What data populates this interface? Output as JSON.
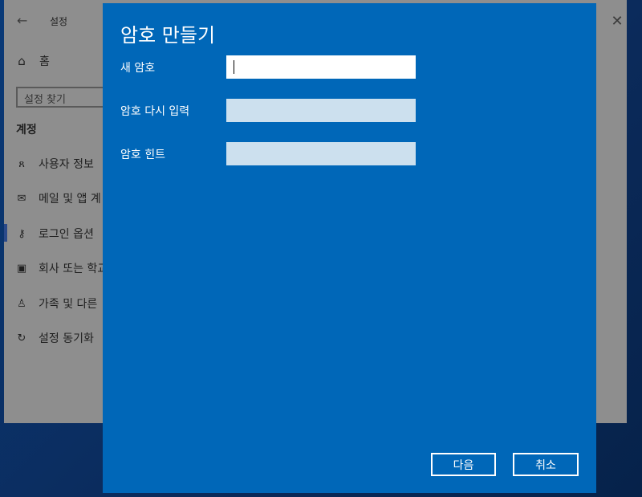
{
  "settings": {
    "title": "설정",
    "home_label": "홈",
    "search_placeholder": "설정 찾기",
    "section": "계정",
    "nav": [
      {
        "icon": "user-info-icon",
        "label": "사용자 정보"
      },
      {
        "icon": "mail-icon",
        "label": "메일 및 앱 계"
      },
      {
        "icon": "key-icon",
        "label": "로그인 옵션"
      },
      {
        "icon": "briefcase-icon",
        "label": "회사 또는 학교"
      },
      {
        "icon": "add-user-icon",
        "label": "가족 및 다른"
      },
      {
        "icon": "sync-icon",
        "label": "설정 동기화"
      }
    ]
  },
  "dialog": {
    "title": "암호 만들기",
    "new_password_label": "새 암호",
    "reenter_label": "암호 다시 입력",
    "hint_label": "암호 힌트",
    "next_button": "다음",
    "cancel_button": "취소"
  },
  "colors": {
    "dialog_bg": "#0067b8",
    "settings_bg": "#8e8e8e"
  }
}
